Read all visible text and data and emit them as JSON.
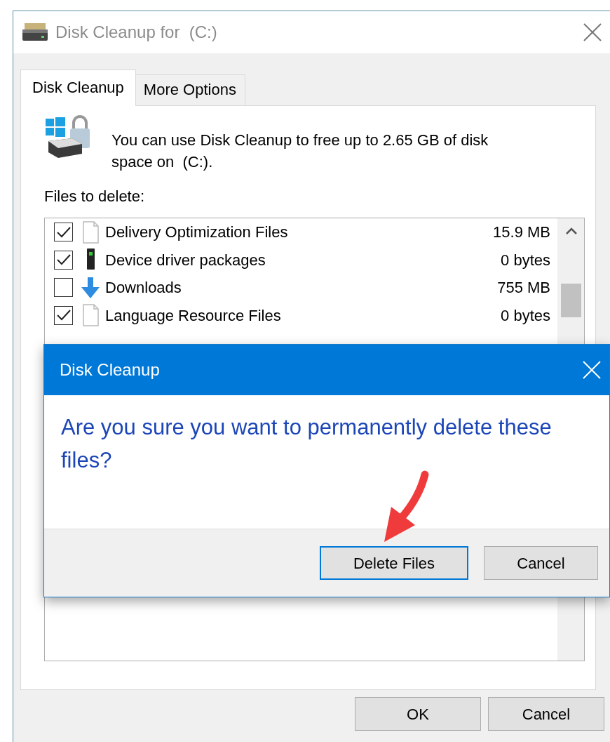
{
  "window": {
    "title": "Disk Cleanup for  (C:)"
  },
  "tabs": [
    {
      "label": "Disk Cleanup",
      "selected": true
    },
    {
      "label": "More Options",
      "selected": false
    }
  ],
  "description": "You can use Disk Cleanup to free up to 2.65 GB of disk space on  (C:).",
  "files_label": "Files to delete:",
  "files": [
    {
      "kind": "document",
      "name": "Delivery Optimization Files",
      "size": "15.9 MB",
      "checked": true
    },
    {
      "kind": "driver",
      "name": "Device driver packages",
      "size": "0 bytes",
      "checked": true
    },
    {
      "kind": "download",
      "name": "Downloads",
      "size": "755 MB",
      "checked": false
    },
    {
      "kind": "document",
      "name": "Language Resource Files",
      "size": "0 bytes",
      "checked": true
    }
  ],
  "buttons": [
    "OK",
    "Cancel"
  ],
  "dialog": {
    "title": "Disk Cleanup",
    "message": "Are you sure you want to permanently delete these files?",
    "buttons": [
      {
        "label": "Delete Files",
        "default": true
      },
      {
        "label": "Cancel",
        "default": false
      }
    ]
  }
}
